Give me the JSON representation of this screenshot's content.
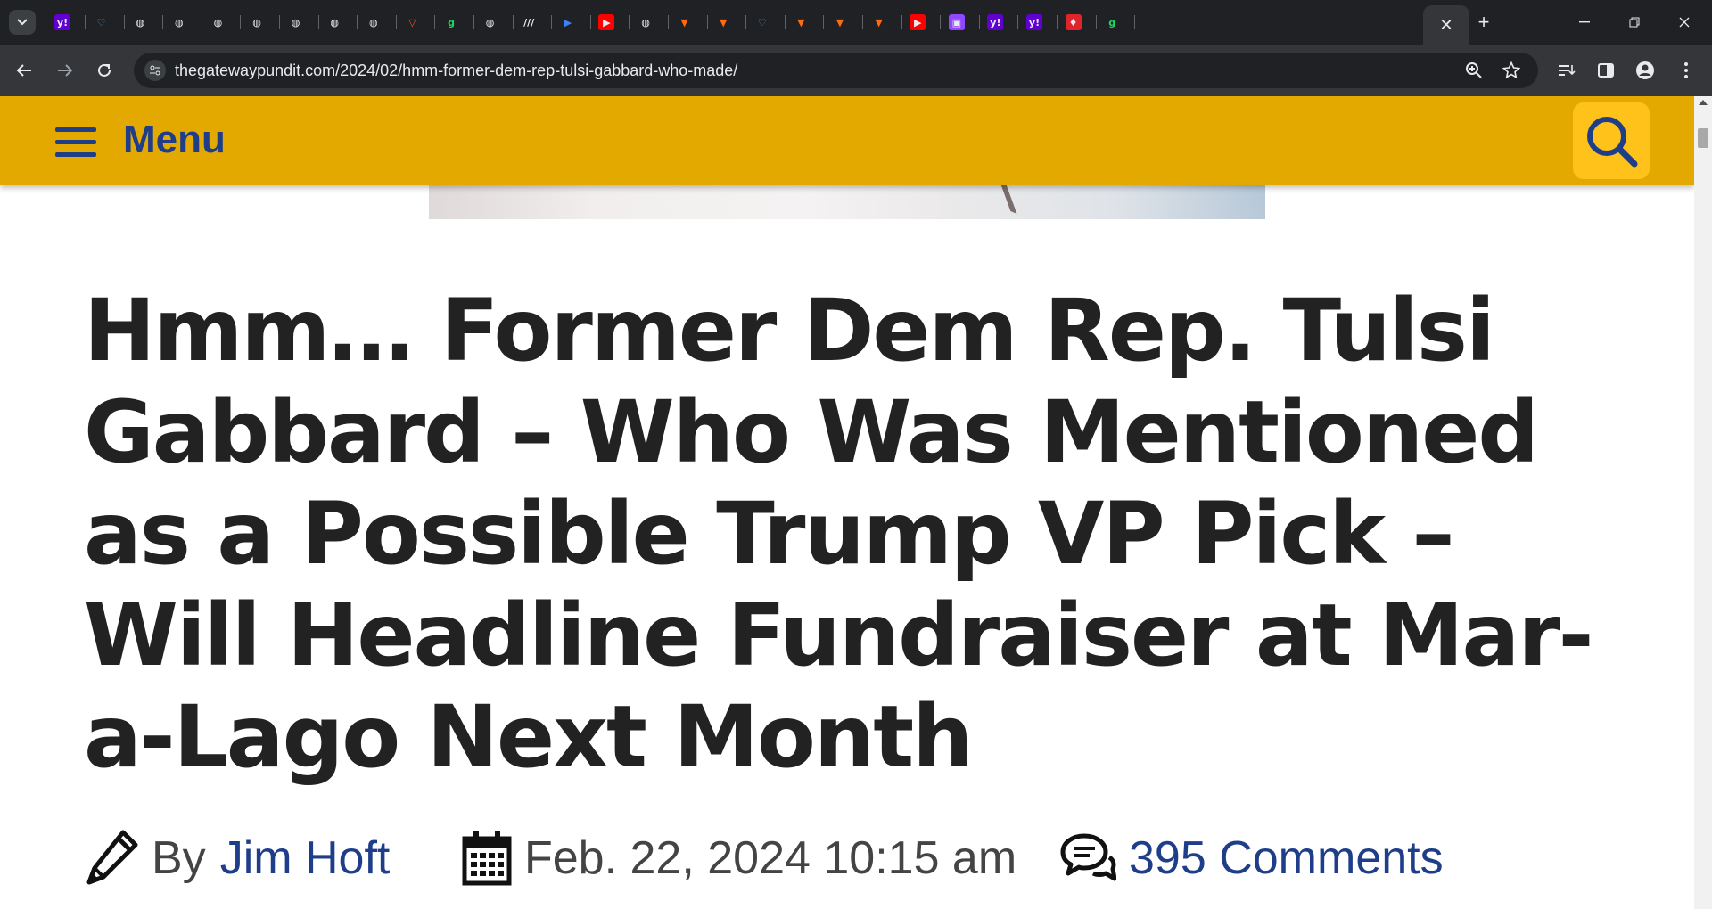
{
  "browser": {
    "tabs": [
      {
        "icon": "yahoo-icon",
        "glyph": "y!",
        "color": "#6001d2"
      },
      {
        "icon": "shield-heart-icon",
        "glyph": "♡",
        "color": "#202124"
      },
      {
        "icon": "globe-icon",
        "glyph": "◍",
        "color": "#202124"
      },
      {
        "icon": "globe-icon",
        "glyph": "◍",
        "color": "#202124"
      },
      {
        "icon": "globe-icon",
        "glyph": "◍",
        "color": "#202124"
      },
      {
        "icon": "globe-icon",
        "glyph": "◍",
        "color": "#202124"
      },
      {
        "icon": "globe-icon",
        "glyph": "◍",
        "color": "#202124"
      },
      {
        "icon": "globe-icon",
        "glyph": "◍",
        "color": "#202124"
      },
      {
        "icon": "globe-icon",
        "glyph": "◍",
        "color": "#202124"
      },
      {
        "icon": "brave-shield-icon",
        "glyph": "▽",
        "color": "#202124"
      },
      {
        "icon": "green-g-icon",
        "glyph": "g",
        "color": "#202124"
      },
      {
        "icon": "globe-icon",
        "glyph": "◍",
        "color": "#202124"
      },
      {
        "icon": "slash-logo-icon",
        "glyph": "///",
        "color": "#202124"
      },
      {
        "icon": "blue-arrow-icon",
        "glyph": "▶",
        "color": "#202124"
      },
      {
        "icon": "youtube-icon",
        "glyph": "▶",
        "color": "#ff0000"
      },
      {
        "icon": "globe-icon",
        "glyph": "◍",
        "color": "#202124"
      },
      {
        "icon": "bookmark-orange-icon",
        "glyph": "▼",
        "color": "#202124"
      },
      {
        "icon": "bookmark-orange-icon",
        "glyph": "▼",
        "color": "#202124"
      },
      {
        "icon": "shield-heart-icon",
        "glyph": "♡",
        "color": "#202124"
      },
      {
        "icon": "bookmark-orange-icon",
        "glyph": "▼",
        "color": "#202124"
      },
      {
        "icon": "bookmark-orange-icon",
        "glyph": "▼",
        "color": "#202124"
      },
      {
        "icon": "bookmark-orange-icon",
        "glyph": "▼",
        "color": "#202124"
      },
      {
        "icon": "youtube-icon",
        "glyph": "▶",
        "color": "#ff0000"
      },
      {
        "icon": "twitch-icon",
        "glyph": "▣",
        "color": "#9146ff"
      },
      {
        "icon": "yahoo-icon",
        "glyph": "y!",
        "color": "#6001d2"
      },
      {
        "icon": "yahoo-icon",
        "glyph": "y!",
        "color": "#6001d2"
      },
      {
        "icon": "red-pin-icon",
        "glyph": "♦",
        "color": "#e0242b"
      },
      {
        "icon": "green-g-icon",
        "glyph": "g",
        "color": "#202124"
      }
    ],
    "active_tab_close": "✕",
    "new_tab": "+",
    "url": "thegatewaypundit.com/2024/02/hmm-former-dem-rep-tulsi-gabbard-who-made/"
  },
  "site": {
    "menu_label": "Menu",
    "header_color": "#e4a900",
    "brand_color": "#1f3e8a"
  },
  "article": {
    "headline": "Hmm… Former Dem Rep. Tulsi Gabbard – Who Was Mentioned as a Possible Trump VP Pick – Will Headline Fundraiser at Mar-a-Lago Next Month",
    "by_label": "By",
    "author": "Jim Hoft",
    "date": "Feb. 22, 2024 10:15 am",
    "comments": "395 Comments"
  }
}
